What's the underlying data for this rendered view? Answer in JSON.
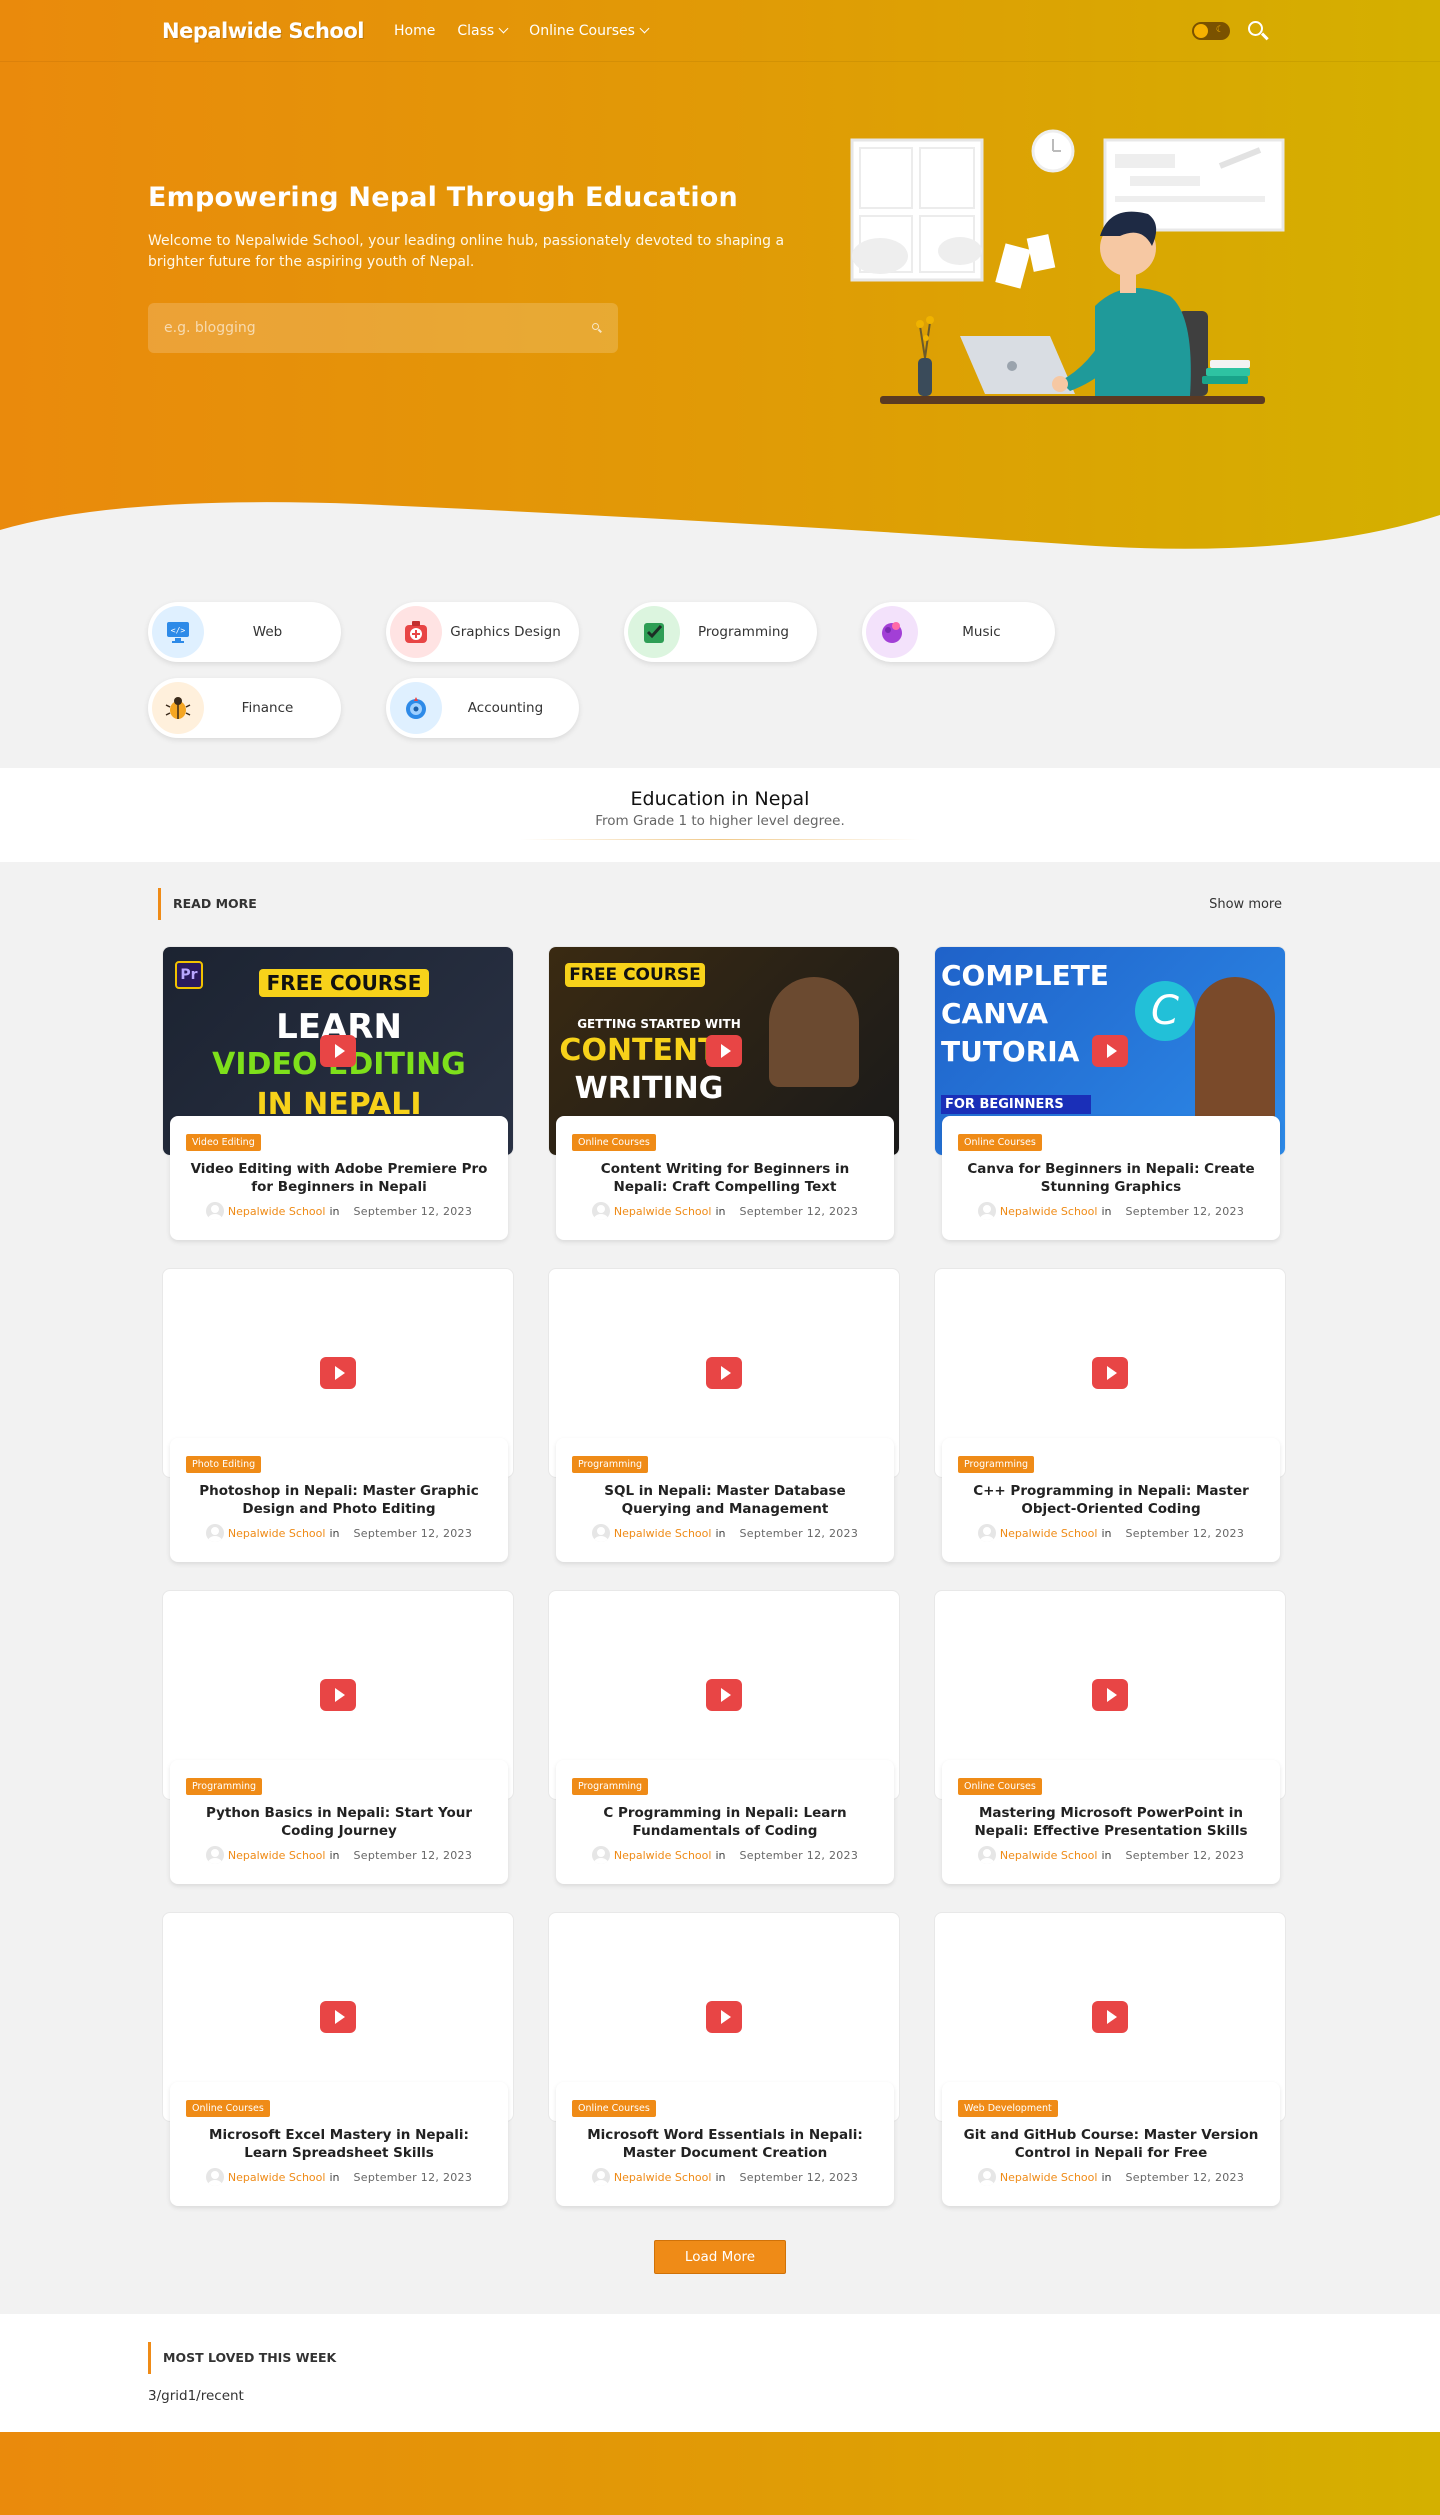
{
  "header": {
    "logo": "Nepalwide School",
    "nav": [
      {
        "label": "Home",
        "has_dropdown": false
      },
      {
        "label": "Class",
        "has_dropdown": true
      },
      {
        "label": "Online Courses",
        "has_dropdown": true
      }
    ],
    "icons": [
      "theme-toggle",
      "search-icon"
    ]
  },
  "hero": {
    "title": "Empowering Nepal Through Education",
    "description": "Welcome to Nepalwide School, your leading online hub, passionately devoted to shaping a brighter future for the aspiring youth of Nepal.",
    "search_placeholder": "e.g. blogging"
  },
  "categories": [
    {
      "label": "Web",
      "icon": "code-monitor-icon",
      "bg": "#dff0ff"
    },
    {
      "label": "Graphics Design",
      "icon": "graphics-kit-icon",
      "bg": "#ffe3e3"
    },
    {
      "label": "Programming",
      "icon": "checkbox-icon",
      "bg": "#dcf5df"
    },
    {
      "label": "Music",
      "icon": "music-orb-icon",
      "bg": "#f3e2fb"
    },
    {
      "label": "Finance",
      "icon": "bug-icon",
      "bg": "#fff0dc"
    },
    {
      "label": "Accounting",
      "icon": "target-icon",
      "bg": "#dff0ff"
    }
  ],
  "education": {
    "title": "Education in Nepal",
    "subtitle": "From Grade 1 to higher level degree."
  },
  "posts_section": {
    "title": "READ MORE",
    "show_more": "Show more",
    "load_more": "Load More",
    "posts": [
      {
        "badge": "Video Editing",
        "title": "Video Editing with Adobe Premiere Pro for Beginners in Nepali",
        "author": "Nepalwide School",
        "in": "in",
        "date": "September 12, 2023",
        "thumb_text": [
          "FREE COURSE",
          "LEARN",
          "VIDEO EDITING",
          "IN NEPALI"
        ]
      },
      {
        "badge": "Online Courses",
        "title": "Content Writing for Beginners in Nepali: Craft Compelling Text",
        "author": "Nepalwide School",
        "in": "in",
        "date": "September 12, 2023",
        "thumb_text": [
          "FREE COURSE",
          "GETTING STARTED WITH",
          "CONTENT",
          "WRITING"
        ]
      },
      {
        "badge": "Online Courses",
        "title": "Canva for Beginners in Nepali: Create Stunning Graphics",
        "author": "Nepalwide School",
        "in": "in",
        "date": "September 12, 2023",
        "thumb_text": [
          "COMPLETE",
          "CANVA",
          "TUTORIA",
          "FOR BEGINNERS"
        ]
      },
      {
        "badge": "Photo Editing",
        "title": "Photoshop in Nepali: Master Graphic Design and Photo Editing",
        "author": "Nepalwide School",
        "in": "in",
        "date": "September 12, 2023"
      },
      {
        "badge": "Programming",
        "title": "SQL in Nepali: Master Database Querying and Management",
        "author": "Nepalwide School",
        "in": "in",
        "date": "September 12, 2023"
      },
      {
        "badge": "Programming",
        "title": "C++ Programming in Nepali: Master Object-Oriented Coding",
        "author": "Nepalwide School",
        "in": "in",
        "date": "September 12, 2023"
      },
      {
        "badge": "Programming",
        "title": "Python Basics in Nepali: Start Your Coding Journey",
        "author": "Nepalwide School",
        "in": "in",
        "date": "September 12, 2023"
      },
      {
        "badge": "Programming",
        "title": "C Programming in Nepali: Learn Fundamentals of Coding",
        "author": "Nepalwide School",
        "in": "in",
        "date": "September 12, 2023"
      },
      {
        "badge": "Online Courses",
        "title": "Mastering Microsoft PowerPoint in Nepali: Effective Presentation Skills",
        "author": "Nepalwide School",
        "in": "in",
        "date": "September 12, 2023"
      },
      {
        "badge": "Online Courses",
        "title": "Microsoft Excel Mastery in Nepali: Learn Spreadsheet Skills",
        "author": "Nepalwide School",
        "in": "in",
        "date": "September 12, 2023"
      },
      {
        "badge": "Online Courses",
        "title": "Microsoft Word Essentials in Nepali: Master Document Creation",
        "author": "Nepalwide School",
        "in": "in",
        "date": "September 12, 2023"
      },
      {
        "badge": "Web Development",
        "title": "Git and GitHub Course: Master Version Control in Nepali for Free",
        "author": "Nepalwide School",
        "in": "in",
        "date": "September 12, 2023"
      }
    ]
  },
  "most_loved": {
    "title": "MOST LOVED THIS WEEK",
    "content": "3/grid1/recent"
  },
  "colors": {
    "accent": "#ef8b17",
    "hero_start": "#ea8a0c",
    "hero_end": "#d4b000",
    "play": "#e84545"
  }
}
